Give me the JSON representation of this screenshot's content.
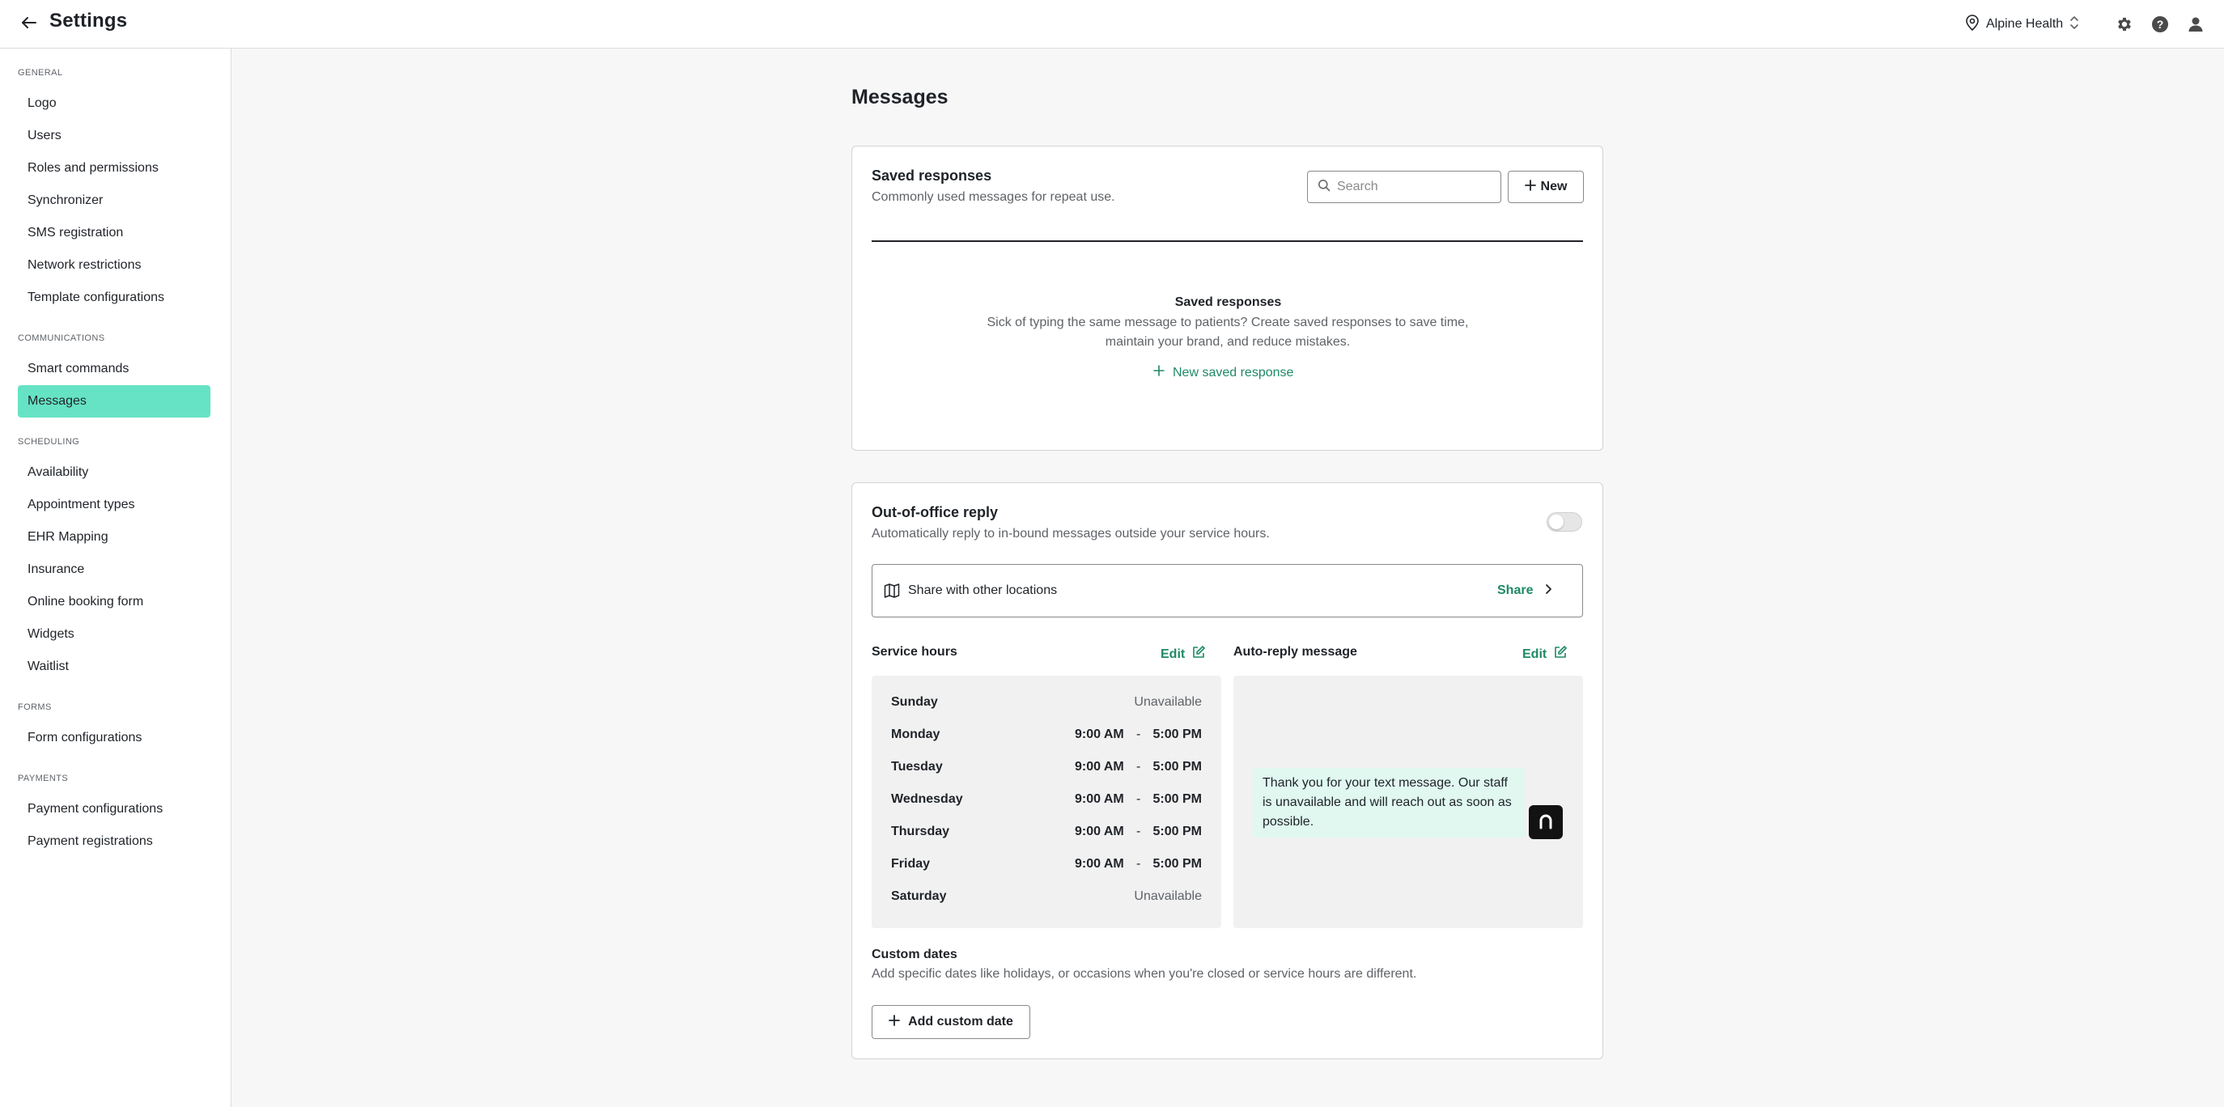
{
  "app": {
    "title": "Settings",
    "location": "Alpine Health"
  },
  "sidebar": {
    "sections": [
      {
        "heading": "GENERAL",
        "items": [
          "Logo",
          "Users",
          "Roles and permissions",
          "Synchronizer",
          "SMS registration",
          "Network restrictions",
          "Template configurations"
        ]
      },
      {
        "heading": "COMMUNICATIONS",
        "items": [
          "Smart commands",
          "Messages"
        ]
      },
      {
        "heading": "SCHEDULING",
        "items": [
          "Availability",
          "Appointment types",
          "EHR Mapping",
          "Insurance",
          "Online booking form",
          "Widgets",
          "Waitlist"
        ]
      },
      {
        "heading": "FORMS",
        "items": [
          "Form configurations"
        ]
      },
      {
        "heading": "PAYMENTS",
        "items": [
          "Payment configurations",
          "Payment registrations"
        ]
      }
    ],
    "active_item": "Messages",
    "active_color": "#66e3c4"
  },
  "main": {
    "page_title": "Messages",
    "saved_responses": {
      "title": "Saved responses",
      "subtitle": "Commonly used messages for repeat use.",
      "search_placeholder": "Search",
      "new_button": "New",
      "empty_title": "Saved responses",
      "empty_description": "Sick of typing the same message to patients? Create saved responses to save time, maintain your brand, and reduce mistakes.",
      "new_link": "New saved response"
    },
    "out_of_office": {
      "title": "Out-of-office reply",
      "subtitle": "Automatically reply to in-bound messages outside your service hours.",
      "enabled": false,
      "share_label": "Share with other locations",
      "share_link": "Share",
      "service_hours_title": "Service hours",
      "auto_reply_title": "Auto-reply message",
      "edit_label": "Edit",
      "hours": [
        {
          "day": "Sunday",
          "open": "",
          "close": "",
          "status": "Unavailable"
        },
        {
          "day": "Monday",
          "open": "9:00 AM",
          "close": "5:00 PM",
          "status": ""
        },
        {
          "day": "Tuesday",
          "open": "9:00 AM",
          "close": "5:00 PM",
          "status": ""
        },
        {
          "day": "Wednesday",
          "open": "9:00 AM",
          "close": "5:00 PM",
          "status": ""
        },
        {
          "day": "Thursday",
          "open": "9:00 AM",
          "close": "5:00 PM",
          "status": ""
        },
        {
          "day": "Friday",
          "open": "9:00 AM",
          "close": "5:00 PM",
          "status": ""
        },
        {
          "day": "Saturday",
          "open": "",
          "close": "",
          "status": "Unavailable"
        }
      ],
      "time_separator": "-",
      "auto_reply_message": "Thank you for your text message. Our staff is unavailable and will reach out as soon as possible.",
      "custom_dates_title": "Custom dates",
      "custom_dates_subtitle": "Add specific dates like holidays, or occasions when you're closed or service hours are different.",
      "add_custom_date": "Add custom date"
    }
  },
  "colors": {
    "accent_green": "#1e8a67",
    "bubble_bg": "#e0f8f0"
  }
}
